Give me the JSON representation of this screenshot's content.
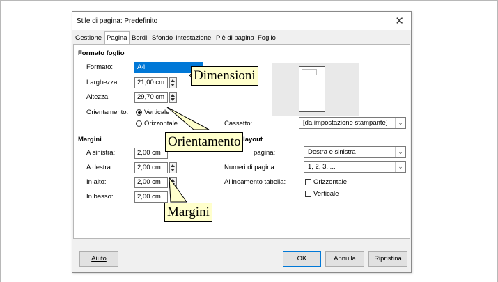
{
  "dialog": {
    "title": "Stile di pagina: Predefinito",
    "close_symbol": "✕"
  },
  "tabs": [
    {
      "label": "Gestione"
    },
    {
      "label": "Pagina"
    },
    {
      "label": "Bordi"
    },
    {
      "label": "Sfondo"
    },
    {
      "label": "Intestazione"
    },
    {
      "label": "Piè di pagina"
    },
    {
      "label": "Foglio"
    }
  ],
  "paper_format": {
    "heading": "Formato foglio",
    "format_label": "Formato:",
    "format_value": "A4",
    "width_label": "Larghezza:",
    "width_value": "21,00 cm",
    "height_label": "Altezza:",
    "height_value": "29,70 cm",
    "orientation_label": "Orientamento:",
    "portrait_label": "Verticale",
    "landscape_label": "Orizzontale",
    "selected_orientation": "Verticale",
    "tray_label": "Cassetto:",
    "tray_value": "[da impostazione stampante]"
  },
  "margins": {
    "heading": "Margini",
    "left_label": "A sinistra:",
    "left_value": "2,00 cm",
    "right_label": "A destra:",
    "right_value": "2,00 cm",
    "top_label": "In alto:",
    "top_value": "2,00 cm",
    "bottom_label": "In basso:",
    "bottom_value": "2,00 cm"
  },
  "layout": {
    "heading_visible": "ni layout",
    "page_layout_label_visible": "pagina:",
    "page_layout_value": "Destra e sinistra",
    "page_numbers_label": "Numeri di pagina:",
    "page_numbers_value": "1, 2, 3, ...",
    "table_alignment_label": "Allineamento tabella:",
    "horizontal_label": "Orizzontale",
    "vertical_label": "Verticale"
  },
  "buttons": {
    "help": "Aiuto",
    "ok": "OK",
    "cancel": "Annulla",
    "reset": "Ripristina"
  },
  "callouts": {
    "dimensions": "Dimensioni",
    "orientation": "Orientamento",
    "margins": "Margini"
  },
  "colors": {
    "selection": "#0078d7",
    "callout_fill": "#ffffcc"
  }
}
